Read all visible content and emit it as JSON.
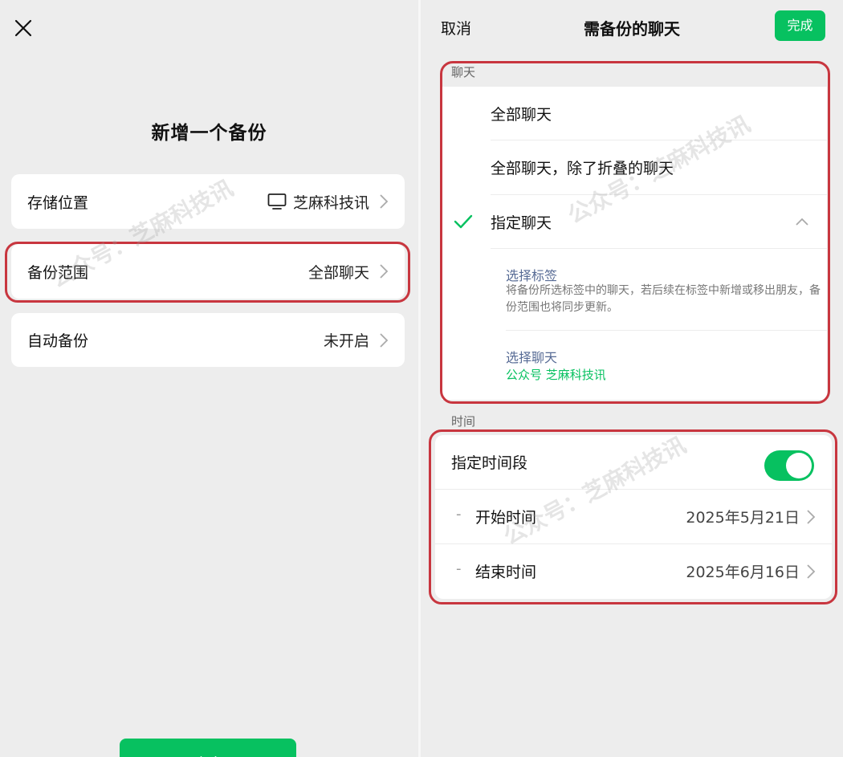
{
  "left": {
    "close_icon": "close-icon",
    "title": "新增一个备份",
    "rows": [
      {
        "label": "存储位置",
        "value": "芝麻科技讯",
        "icon": "monitor-icon"
      },
      {
        "label": "备份范围",
        "value": "全部聊天"
      },
      {
        "label": "自动备份",
        "value": "未开启"
      }
    ],
    "confirm_label": "确定"
  },
  "right": {
    "cancel_label": "取消",
    "title": "需备份的聊天",
    "done_label": "完成",
    "chat_section_label": "聊天",
    "options": [
      {
        "label": "全部聊天",
        "selected": false
      },
      {
        "label": "全部聊天，除了折叠的聊天",
        "selected": false
      },
      {
        "label": "指定聊天",
        "selected": true,
        "expanded": true
      }
    ],
    "select_tags": {
      "title": "选择标签",
      "description": "将备份所选标签中的聊天，若后续在标签中新增或移出朋友，备份范围也将同步更新。"
    },
    "select_chats": {
      "title": "选择聊天",
      "value": "公众号 芝麻科技讯"
    },
    "time_section_label": "时间",
    "time_range": {
      "label": "指定时间段",
      "enabled": true
    },
    "start": {
      "label": "开始时间",
      "value": "2025年5月21日"
    },
    "end": {
      "label": "结束时间",
      "value": "2025年6月16日"
    }
  },
  "watermark": "公众号：芝麻科技讯",
  "colors": {
    "accent": "#07c160",
    "highlight": "#c8363f",
    "link": "#576b95",
    "background": "#ededed"
  }
}
